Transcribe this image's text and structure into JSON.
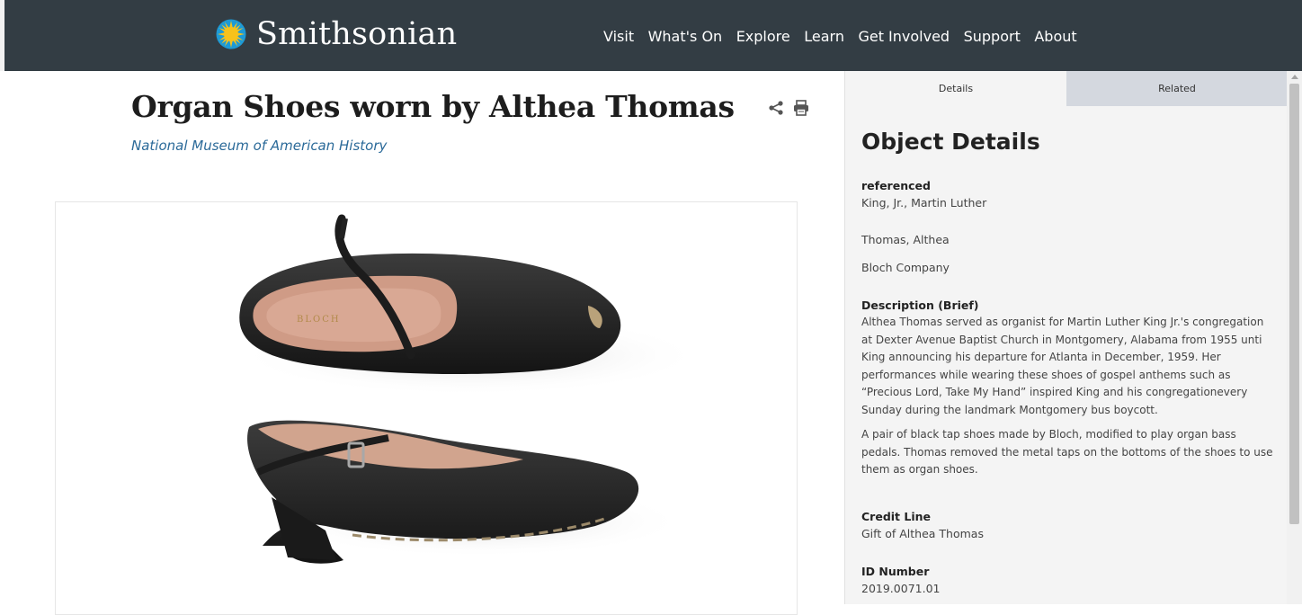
{
  "header": {
    "logo_text": "Smithsonian",
    "nav": [
      "Visit",
      "What's On",
      "Explore",
      "Learn",
      "Get Involved",
      "Support",
      "About"
    ]
  },
  "object": {
    "title": "Organ Shoes worn by Althea Thomas",
    "museum": "National Museum of American History",
    "shoe_brand_print": "BLOCH"
  },
  "actions": {
    "share_icon": "share-icon",
    "print_icon": "print-icon"
  },
  "panel": {
    "tabs": [
      "Details",
      "Related"
    ],
    "heading": "Object Details",
    "referenced_label": "referenced",
    "referenced_values": [
      "King, Jr., Martin Luther",
      "Thomas, Althea",
      "Bloch Company"
    ],
    "description_label": "Description (Brief)",
    "description_1": "Althea Thomas served as organist for Martin Luther King Jr.'s congregation at Dexter Avenue Baptist Church in Montgomery, Alabama from 1955 unti King announcing his departure for Atlanta in December, 1959. Her performances while wearing these shoes of gospel anthems such as “Precious Lord, Take My Hand” inspired King and his congregationevery Sunday during the landmark Montgomery bus boycott.",
    "description_2": "A pair of black tap shoes made by Bloch, modified to play organ bass pedals. Thomas removed the metal taps on the bottoms of the shoes to use them as organ shoes.",
    "credit_label": "Credit Line",
    "credit_value": "Gift of Althea Thomas",
    "id_label": "ID Number",
    "id_value": "2019.0071.01"
  },
  "colors": {
    "header_bg": "#333d44",
    "link_blue": "#2b6a99",
    "sun_yellow": "#f7c21b",
    "sun_blue": "#1d9ad6"
  }
}
